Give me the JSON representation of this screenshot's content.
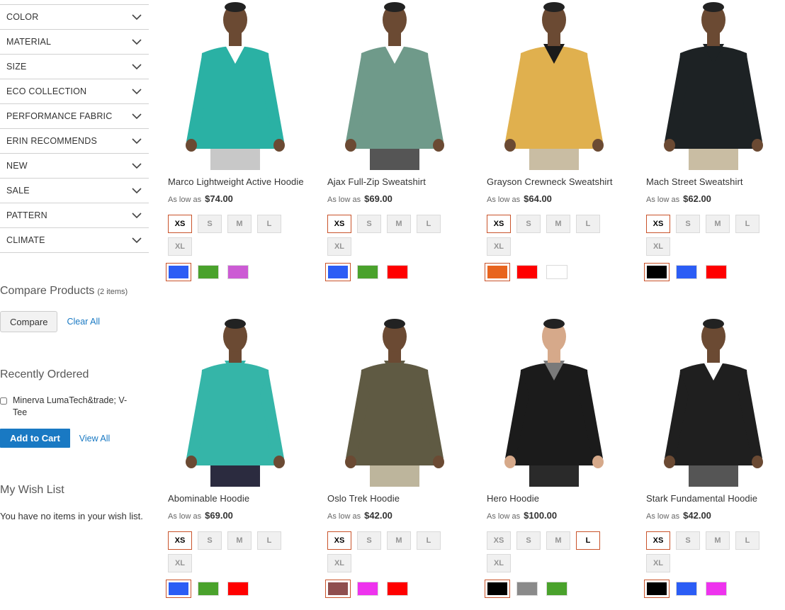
{
  "filters": [
    "COLOR",
    "MATERIAL",
    "SIZE",
    "ECO COLLECTION",
    "PERFORMANCE FABRIC",
    "ERIN RECOMMENDS",
    "NEW",
    "SALE",
    "PATTERN",
    "CLIMATE"
  ],
  "compare": {
    "title": "Compare Products",
    "count": "(2 items)",
    "compare_label": "Compare",
    "clear_label": "Clear All"
  },
  "recent": {
    "title": "Recently Ordered",
    "item": "Minerva LumaTech&trade; V-Tee",
    "add_label": "Add to Cart",
    "view_label": "View All"
  },
  "wishlist": {
    "title": "My Wish List",
    "empty": "You have no items in your wish list."
  },
  "as_low_as": "As low as",
  "products": [
    {
      "name": "Marco Lightweight Active Hoodie",
      "price": "$74.00",
      "sizes": [
        "XS",
        "S",
        "M",
        "L",
        "XL"
      ],
      "selected_size": "XS",
      "colors": [
        "#2b5df5",
        "#4aa22c",
        "#cc5bd4"
      ],
      "selected_color": 0,
      "shirt": "#2ab1a4",
      "pants": "#c8c8c8",
      "under": "#ffffff",
      "skin": "#6b4a33"
    },
    {
      "name": "Ajax Full-Zip Sweatshirt",
      "price": "$69.00",
      "sizes": [
        "XS",
        "S",
        "M",
        "L",
        "XL"
      ],
      "selected_size": "XS",
      "colors": [
        "#2b5df5",
        "#4aa22c",
        "#ff0000"
      ],
      "selected_color": 0,
      "shirt": "#6f9a8a",
      "pants": "#555555",
      "under": "#ffffff",
      "skin": "#6b4a33"
    },
    {
      "name": "Grayson Crewneck Sweatshirt",
      "price": "$64.00",
      "sizes": [
        "XS",
        "S",
        "M",
        "L",
        "XL"
      ],
      "selected_size": "XS",
      "colors": [
        "#e8641e",
        "#ff0000",
        "#ffffff"
      ],
      "selected_color": 0,
      "shirt": "#e0b04e",
      "pants": "#c9bda3",
      "under": "#1a1a1a",
      "skin": "#6b4a33"
    },
    {
      "name": "Mach Street Sweatshirt",
      "price": "$62.00",
      "sizes": [
        "XS",
        "S",
        "M",
        "L",
        "XL"
      ],
      "selected_size": "XS",
      "colors": [
        "#000000",
        "#2b5df5",
        "#ff0000"
      ],
      "selected_color": 0,
      "shirt": "#1d2224",
      "pants": "#c9bda3",
      "under": "#1d2224",
      "skin": "#6b4a33"
    },
    {
      "name": "Abominable Hoodie",
      "price": "$69.00",
      "sizes": [
        "XS",
        "S",
        "M",
        "L",
        "XL"
      ],
      "selected_size": "XS",
      "colors": [
        "#2b5df5",
        "#4aa22c",
        "#ff0000"
      ],
      "selected_color": 0,
      "shirt": "#35b5a8",
      "pants": "#2b2b3f",
      "under": "#35b5a8",
      "skin": "#6b4a33"
    },
    {
      "name": "Oslo Trek Hoodie",
      "price": "$42.00",
      "sizes": [
        "XS",
        "S",
        "M",
        "L",
        "XL"
      ],
      "selected_size": "XS",
      "colors": [
        "#8f4e4e",
        "#ee33ee",
        "#ff0000"
      ],
      "selected_color": 0,
      "shirt": "#5f5a43",
      "pants": "#bdb59c",
      "under": "#5f5a43",
      "skin": "#6b4a33"
    },
    {
      "name": "Hero Hoodie",
      "price": "$100.00",
      "sizes": [
        "XS",
        "S",
        "M",
        "L",
        "XL"
      ],
      "selected_size": "L",
      "colors": [
        "#000000",
        "#8a8a8a",
        "#4aa22c"
      ],
      "selected_color": 0,
      "shirt": "#1b1b1b",
      "pants": "#2a2a2a",
      "under": "#7a7a7a",
      "skin": "#d6a98a"
    },
    {
      "name": "Stark Fundamental Hoodie",
      "price": "$42.00",
      "sizes": [
        "XS",
        "S",
        "M",
        "L",
        "XL"
      ],
      "selected_size": "XS",
      "colors": [
        "#000000",
        "#2b5df5",
        "#ee33ee"
      ],
      "selected_color": 0,
      "shirt": "#1f1f1f",
      "pants": "#555555",
      "under": "#ffffff",
      "skin": "#6b4a33"
    }
  ]
}
